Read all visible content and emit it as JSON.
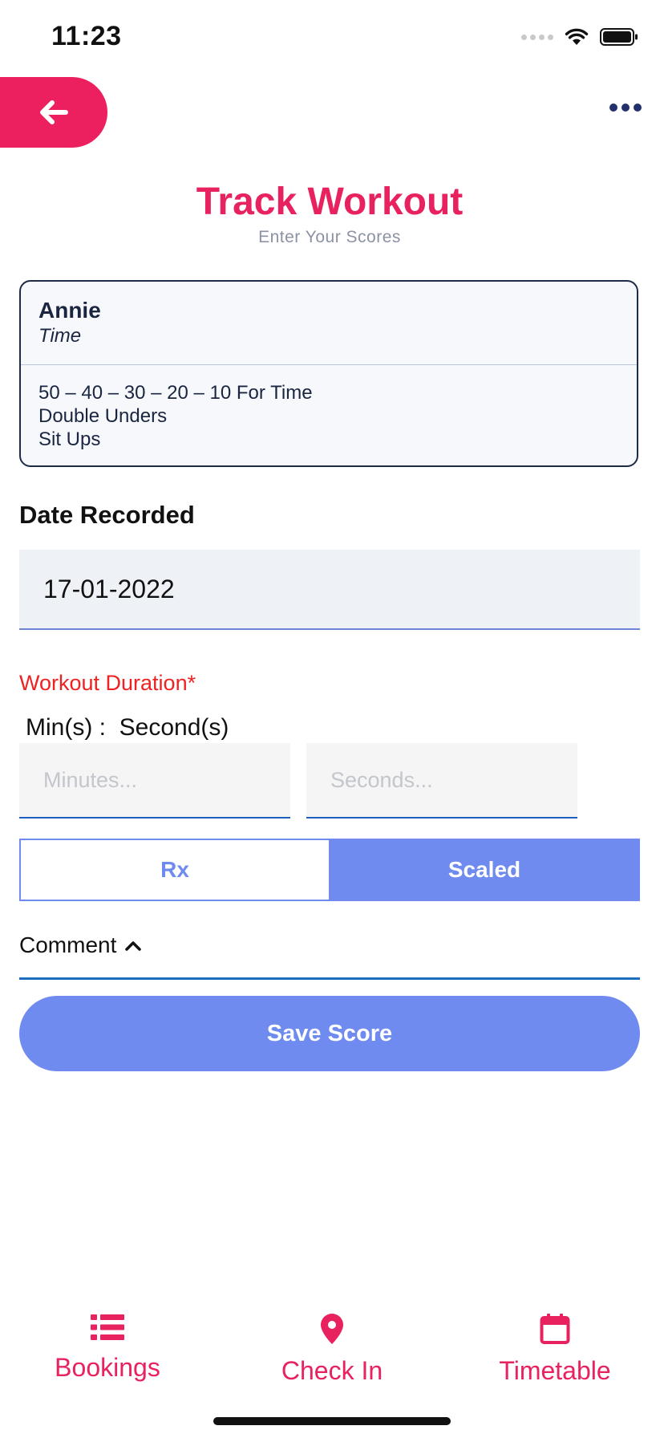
{
  "status_bar": {
    "time": "11:23"
  },
  "header": {
    "title": "Track Workout",
    "subtitle": "Enter Your Scores"
  },
  "workout": {
    "name": "Annie",
    "type": "Time",
    "lines": [
      "50 – 40 – 30 – 20 – 10 For Time",
      "Double Unders",
      "Sit Ups"
    ]
  },
  "date": {
    "label": "Date Recorded",
    "value": "17-01-2022"
  },
  "duration": {
    "label": "Workout Duration*",
    "sub_label": "Min(s) :  Second(s)",
    "minutes_placeholder": "Minutes...",
    "seconds_placeholder": "Seconds..."
  },
  "scale_toggle": {
    "options": [
      "Rx",
      "Scaled"
    ],
    "selected": "Scaled"
  },
  "comment": {
    "label": "Comment"
  },
  "save_button": {
    "label": "Save Score"
  },
  "tabs": [
    {
      "label": "Bookings",
      "icon": "list-icon"
    },
    {
      "label": "Check In",
      "icon": "map-pin-icon"
    },
    {
      "label": "Timetable",
      "icon": "calendar-icon"
    }
  ],
  "colors": {
    "brand_pink": "#e8215f",
    "accent_blue": "#6f8bef",
    "required_red": "#ef2222"
  }
}
